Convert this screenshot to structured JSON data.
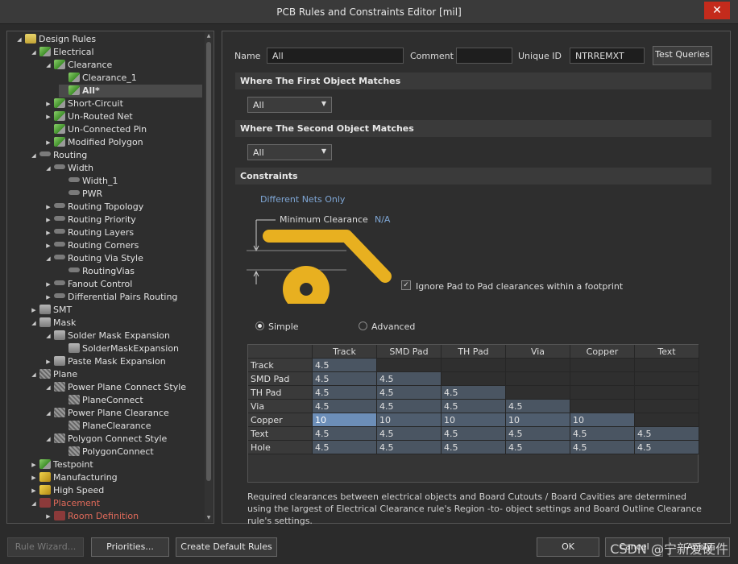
{
  "window": {
    "title": "PCB Rules and Constraints Editor [mil]",
    "close_glyph": "✕"
  },
  "tree": [
    {
      "label": "Design Rules",
      "depth": 0,
      "twisty": "◢",
      "icon": "folder"
    },
    {
      "label": "Electrical",
      "depth": 1,
      "twisty": "◢",
      "icon": "green"
    },
    {
      "label": "Clearance",
      "depth": 2,
      "twisty": "◢",
      "icon": "green"
    },
    {
      "label": "Clearance_1",
      "depth": 3,
      "twisty": "",
      "icon": "green"
    },
    {
      "label": "All*",
      "depth": 3,
      "twisty": "",
      "icon": "green",
      "selected": true,
      "bold": true
    },
    {
      "label": "Short-Circuit",
      "depth": 2,
      "twisty": "▶",
      "icon": "green"
    },
    {
      "label": "Un-Routed Net",
      "depth": 2,
      "twisty": "▶",
      "icon": "green"
    },
    {
      "label": "Un-Connected Pin",
      "depth": 2,
      "twisty": "",
      "icon": "green"
    },
    {
      "label": "Modified Polygon",
      "depth": 2,
      "twisty": "▶",
      "icon": "green"
    },
    {
      "label": "Routing",
      "depth": 1,
      "twisty": "◢",
      "icon": "route"
    },
    {
      "label": "Width",
      "depth": 2,
      "twisty": "◢",
      "icon": "route"
    },
    {
      "label": "Width_1",
      "depth": 3,
      "twisty": "",
      "icon": "route"
    },
    {
      "label": "PWR",
      "depth": 3,
      "twisty": "",
      "icon": "route"
    },
    {
      "label": "Routing Topology",
      "depth": 2,
      "twisty": "▶",
      "icon": "route"
    },
    {
      "label": "Routing Priority",
      "depth": 2,
      "twisty": "▶",
      "icon": "route"
    },
    {
      "label": "Routing Layers",
      "depth": 2,
      "twisty": "▶",
      "icon": "route"
    },
    {
      "label": "Routing Corners",
      "depth": 2,
      "twisty": "▶",
      "icon": "route"
    },
    {
      "label": "Routing Via Style",
      "depth": 2,
      "twisty": "◢",
      "icon": "route"
    },
    {
      "label": "RoutingVias",
      "depth": 3,
      "twisty": "",
      "icon": "route"
    },
    {
      "label": "Fanout Control",
      "depth": 2,
      "twisty": "▶",
      "icon": "route"
    },
    {
      "label": "Differential Pairs Routing",
      "depth": 2,
      "twisty": "▶",
      "icon": "route"
    },
    {
      "label": "SMT",
      "depth": 1,
      "twisty": "▶",
      "icon": "grey"
    },
    {
      "label": "Mask",
      "depth": 1,
      "twisty": "◢",
      "icon": "grey"
    },
    {
      "label": "Solder Mask Expansion",
      "depth": 2,
      "twisty": "◢",
      "icon": "grey"
    },
    {
      "label": "SolderMaskExpansion",
      "depth": 3,
      "twisty": "",
      "icon": "grey"
    },
    {
      "label": "Paste Mask Expansion",
      "depth": 2,
      "twisty": "▶",
      "icon": "grey"
    },
    {
      "label": "Plane",
      "depth": 1,
      "twisty": "◢",
      "icon": "plane"
    },
    {
      "label": "Power Plane Connect Style",
      "depth": 2,
      "twisty": "◢",
      "icon": "plane"
    },
    {
      "label": "PlaneConnect",
      "depth": 3,
      "twisty": "",
      "icon": "plane"
    },
    {
      "label": "Power Plane Clearance",
      "depth": 2,
      "twisty": "◢",
      "icon": "plane"
    },
    {
      "label": "PlaneClearance",
      "depth": 3,
      "twisty": "",
      "icon": "plane"
    },
    {
      "label": "Polygon Connect Style",
      "depth": 2,
      "twisty": "◢",
      "icon": "plane"
    },
    {
      "label": "PolygonConnect",
      "depth": 3,
      "twisty": "",
      "icon": "plane"
    },
    {
      "label": "Testpoint",
      "depth": 1,
      "twisty": "▶",
      "icon": "green"
    },
    {
      "label": "Manufacturing",
      "depth": 1,
      "twisty": "▶",
      "icon": "yellow"
    },
    {
      "label": "High Speed",
      "depth": 1,
      "twisty": "▶",
      "icon": "yellow"
    },
    {
      "label": "Placement",
      "depth": 1,
      "twisty": "◢",
      "icon": "red",
      "red": true
    },
    {
      "label": "Room Definition",
      "depth": 2,
      "twisty": "▶",
      "icon": "red",
      "red": true
    }
  ],
  "rule": {
    "name_label": "Name",
    "name_value": "All",
    "comment_label": "Comment",
    "comment_value": "",
    "uid_label": "Unique ID",
    "uid_value": "NTRREMXT",
    "test_queries": "Test Queries"
  },
  "first_match": {
    "header": "Where The First Object Matches",
    "value": "All"
  },
  "second_match": {
    "header": "Where The Second Object Matches",
    "value": "All"
  },
  "constraints": {
    "header": "Constraints",
    "nets_mode": "Different Nets Only",
    "min_clearance_label": "Minimum Clearance",
    "min_clearance_value": "N/A",
    "ignore_pad_label": "Ignore Pad to Pad clearances within a footprint",
    "ignore_pad_checked": true,
    "mode_simple": "Simple",
    "mode_advanced": "Advanced",
    "selected_mode": "simple"
  },
  "matrix": {
    "columns": [
      "Track",
      "SMD Pad",
      "TH Pad",
      "Via",
      "Copper",
      "Text"
    ],
    "rows": [
      {
        "label": "Track",
        "values": [
          "4.5"
        ]
      },
      {
        "label": "SMD Pad",
        "values": [
          "4.5",
          "4.5"
        ]
      },
      {
        "label": "TH Pad",
        "values": [
          "4.5",
          "4.5",
          "4.5"
        ]
      },
      {
        "label": "Via",
        "values": [
          "4.5",
          "4.5",
          "4.5",
          "4.5"
        ]
      },
      {
        "label": "Copper",
        "values": [
          "10",
          "10",
          "10",
          "10",
          "10"
        ],
        "highlight": true
      },
      {
        "label": "Text",
        "values": [
          "4.5",
          "4.5",
          "4.5",
          "4.5",
          "4.5",
          "4.5"
        ]
      },
      {
        "label": "Hole",
        "values": [
          "4.5",
          "4.5",
          "4.5",
          "4.5",
          "4.5",
          "4.5"
        ]
      }
    ]
  },
  "note": "Required clearances between electrical objects and Board Cutouts / Board Cavities are determined using the largest of Electrical Clearance rule's Region -to- object settings and Board Outline Clearance rule's settings.",
  "footer": {
    "rule_wizard": "Rule Wizard...",
    "priorities": "Priorities...",
    "create_defaults": "Create Default Rules",
    "ok": "OK",
    "cancel": "Cancel",
    "apply": "Apply"
  },
  "watermark": "CSDN @宁新爱硬件",
  "colors": {
    "trace": "#e8b020",
    "accent_blue": "#7fa7d6",
    "highlight": "#6c8eb8",
    "placement_red": "#e06a5a"
  }
}
